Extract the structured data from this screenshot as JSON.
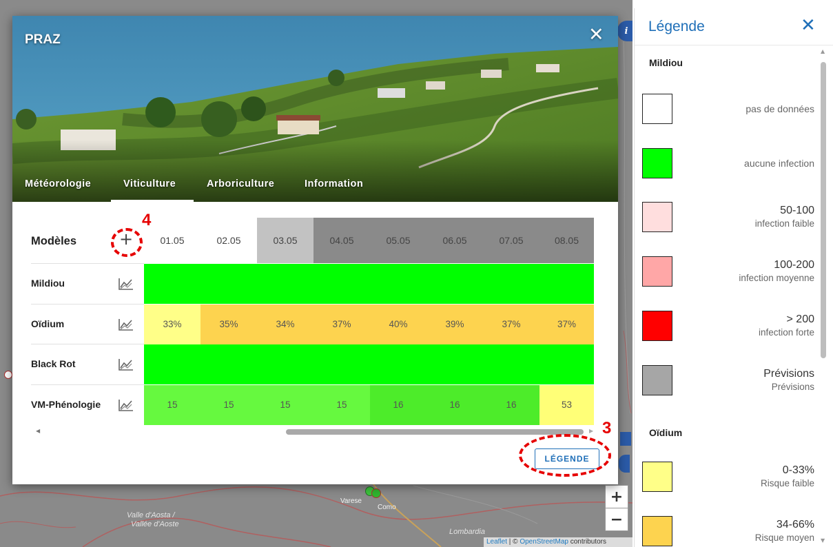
{
  "map": {
    "labels": {
      "valle_aosta": "Valle d'Aosta /",
      "vallee_aoste": "Vallée d'Aoste",
      "lombardia": "Lombardia",
      "varese": "Varese",
      "como": "Como"
    },
    "zoom_in": "+",
    "zoom_out": "−",
    "attribution": {
      "leaflet": "Leaflet",
      "separator": " | © ",
      "osm": "OpenStreetMap",
      "contributors": " contributors"
    },
    "info_icon": "i"
  },
  "modal": {
    "title": "PRAZ",
    "close": "✕",
    "tabs": [
      {
        "label": "Météorologie"
      },
      {
        "label": "Viticulture",
        "active": true
      },
      {
        "label": "Arboriculture"
      },
      {
        "label": "Information"
      }
    ],
    "table": {
      "header_label": "Modèles",
      "add_icon": "+",
      "dates": [
        "01.05",
        "02.05",
        "03.05",
        "04.05",
        "05.05",
        "06.05",
        "07.05",
        "08.05"
      ],
      "date_colors": [
        "#ffffff",
        "#ffffff",
        "#c2c2c2",
        "#8a8a8a",
        "#8a8a8a",
        "#8a8a8a",
        "#8a8a8a",
        "#8a8a8a"
      ],
      "rows": [
        {
          "label": "Mildiou",
          "cells": [
            "",
            "",
            "",
            "",
            "",
            "",
            "",
            ""
          ],
          "colors": [
            "#00ff00",
            "#00ff00",
            "#00ff00",
            "#00ff00",
            "#00ff00",
            "#00ff00",
            "#00ff00",
            "#00ff00"
          ]
        },
        {
          "label": "Oïdium",
          "cells": [
            "33%",
            "35%",
            "34%",
            "37%",
            "40%",
            "39%",
            "37%",
            "37%"
          ],
          "colors": [
            "#ffff88",
            "#fdd34f",
            "#fdd34f",
            "#fdd34f",
            "#fdd34f",
            "#fdd34f",
            "#fdd34f",
            "#fdd34f"
          ]
        },
        {
          "label": "Black Rot",
          "cells": [
            "",
            "",
            "",
            "",
            "",
            "",
            "",
            ""
          ],
          "colors": [
            "#00ff00",
            "#00ff00",
            "#00ff00",
            "#00ff00",
            "#00ff00",
            "#00ff00",
            "#00ff00",
            "#00ff00"
          ]
        },
        {
          "label": "VM-Phénologie",
          "cells": [
            "15",
            "15",
            "15",
            "15",
            "16",
            "16",
            "16",
            "53"
          ],
          "colors": [
            "#66f93f",
            "#66f93f",
            "#66f93f",
            "#66f93f",
            "#4dec2a",
            "#4dec2a",
            "#4dec2a",
            "#ffff77"
          ]
        }
      ]
    },
    "legend_button": "LÉGENDE"
  },
  "annotations": {
    "four": "4",
    "three": "3"
  },
  "legend": {
    "title": "Légende",
    "close": "✕",
    "sections": [
      {
        "title": "Mildiou"
      },
      {
        "title": "Oïdium"
      }
    ],
    "items": [
      {
        "color": "#ffffff",
        "label": "pas de données",
        "sub": ""
      },
      {
        "color": "#00ff00",
        "label": "aucune infection",
        "sub": ""
      },
      {
        "color": "#ffdede",
        "label": "50-100",
        "sub": "infection faible"
      },
      {
        "color": "#ffa7a7",
        "label": "100-200",
        "sub": "infection moyenne"
      },
      {
        "color": "#ff0000",
        "label": "> 200",
        "sub": "infection forte"
      },
      {
        "color": "#a6a6a6",
        "label": "Prévisions",
        "sub": "Prévisions"
      },
      {
        "color": "#ffff88",
        "label": "0-33%",
        "sub": "Risque faible"
      },
      {
        "color": "#fdd34f",
        "label": "34-66%",
        "sub": "Risque moyen"
      }
    ]
  }
}
